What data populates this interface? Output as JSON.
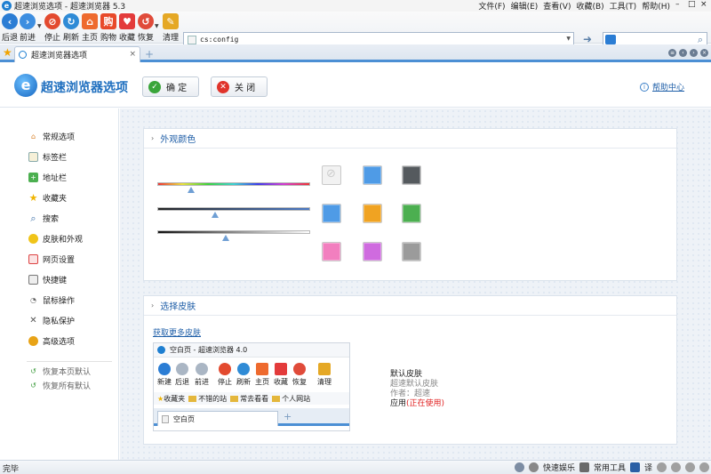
{
  "window": {
    "title": "超速浏览选项 - 超速浏览器 5.3",
    "menu": [
      "文件(F)",
      "编辑(E)",
      "查看(V)",
      "收藏(B)",
      "工具(T)",
      "帮助(H)"
    ]
  },
  "toolbar": {
    "buttons": [
      "后退",
      "前进",
      "停止",
      "刷新",
      "主页",
      "购物",
      "收藏",
      "恢复",
      "清理"
    ],
    "address": "cs:config",
    "search_placeholder": ""
  },
  "tabs": [
    {
      "label": "超速浏览器选项",
      "active": true
    }
  ],
  "options_header": {
    "title": "超速浏览器选项",
    "ok_label": "确 定",
    "close_label": "关 闭",
    "help_label": "帮助中心"
  },
  "sidebar": {
    "items": [
      "常规选项",
      "标签栏",
      "地址栏",
      "收藏夹",
      "搜索",
      "皮肤和外观",
      "网页设置",
      "快捷键",
      "鼠标操作",
      "隐私保护",
      "高级选项"
    ],
    "reset_items": [
      "恢复本页默认",
      "恢复所有默认"
    ]
  },
  "appearance": {
    "title": "外观颜色",
    "sliders": [
      {
        "name": "hue",
        "value": 0.22
      },
      {
        "name": "saturation",
        "value": 0.38
      },
      {
        "name": "lightness",
        "value": 0.45
      }
    ],
    "swatches": [
      "none",
      "#4f9be6",
      "#555a5e",
      "#4f9be6",
      "#f0a322",
      "#4caf50",
      "#f27fbf",
      "#cf6bdf",
      "#9b9b9b"
    ]
  },
  "skin": {
    "title": "选择皮肤",
    "more_link": "获取更多皮肤",
    "preview": {
      "title": "空白页 - 超速浏览器 4.0",
      "tools": [
        "新建",
        "后退",
        "前进",
        "停止",
        "刷新",
        "主页",
        "收藏",
        "恢复",
        "清理"
      ],
      "favbar": [
        "收藏夹",
        "不错的站",
        "常去看看",
        "个人网站"
      ],
      "tab_label": "空白页"
    },
    "info": {
      "name": "默认皮肤",
      "desc": "超速默认皮肤",
      "author": "作者：超速",
      "apply_prefix": "应用",
      "status": "(正在使用)"
    }
  },
  "statusbar": {
    "left": "完毕",
    "right": [
      "快速娱乐",
      "常用工具",
      "译"
    ]
  }
}
